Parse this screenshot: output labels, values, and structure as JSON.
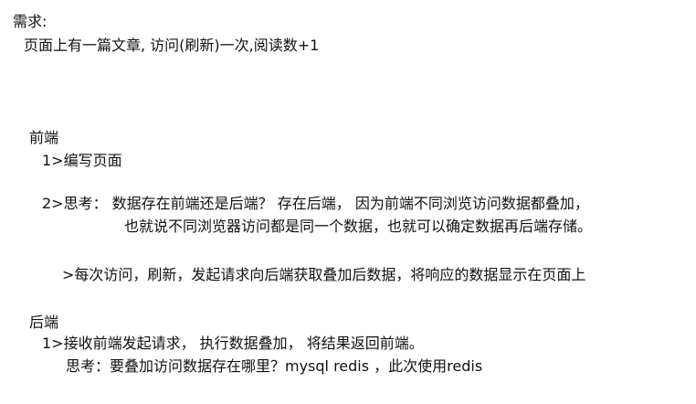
{
  "requirement": {
    "heading": "需求:",
    "description": "页面上有一篇文章, 访问(刷新)一次,阅读数+1"
  },
  "frontend": {
    "heading": "前端",
    "step1": "1>编写页面",
    "step2_line1": "2>思考：  数据存在前端还是后端？  存在后端，  因为前端不同浏览访问数据都叠加，",
    "step2_line2": "也就说不同浏览器访问都是同一个数据，也就可以确定数据再后端存储。",
    "step3": ">每次访问，刷新，发起请求向后端获取叠加后数据，将响应的数据显示在页面上"
  },
  "backend": {
    "heading": "后端",
    "step1": "1>接收前端发起请求，  执行数据叠加，  将结果返回前端。",
    "thinking": "思考：要叠加访问数据存在哪里？mysql   redis ，此次使用redis"
  }
}
